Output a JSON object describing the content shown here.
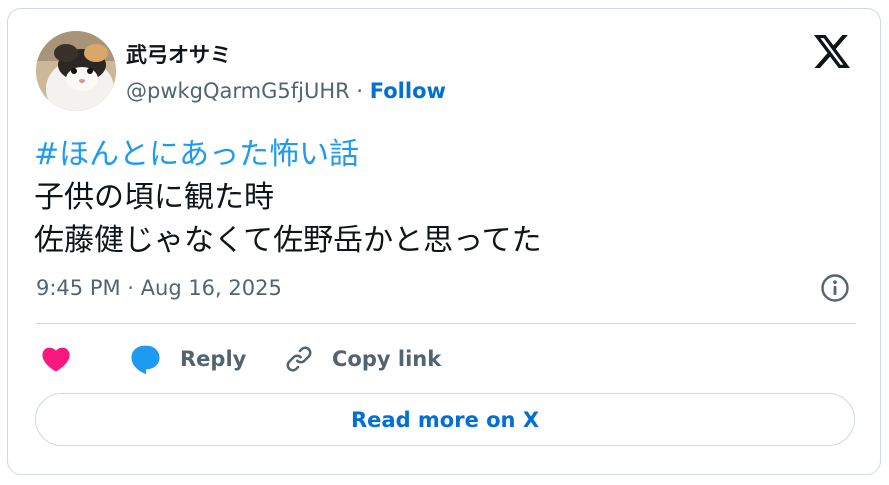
{
  "author": {
    "display_name": "武弓オサミ",
    "handle": "@pwkgQarmG5fjUHR",
    "separator": " · ",
    "follow_label": "Follow"
  },
  "tweet": {
    "hashtag": "#ほんとにあった怖い話",
    "lines": [
      "子供の頃に観た時",
      "佐藤健じゃなくて佐野岳かと思ってた"
    ],
    "timestamp": "9:45 PM · Aug 16, 2025"
  },
  "actions": {
    "like_icon": "heart-icon",
    "reply_label": "Reply",
    "copy_link_label": "Copy link"
  },
  "read_more_label": "Read more on X",
  "colors": {
    "link": "#006fd6",
    "hashtag": "#1d9bf0",
    "like": "#f91880",
    "reply_icon": "#1d9bf0",
    "text_primary": "#0f1419",
    "text_secondary": "#536471",
    "border": "#cfd9de"
  }
}
